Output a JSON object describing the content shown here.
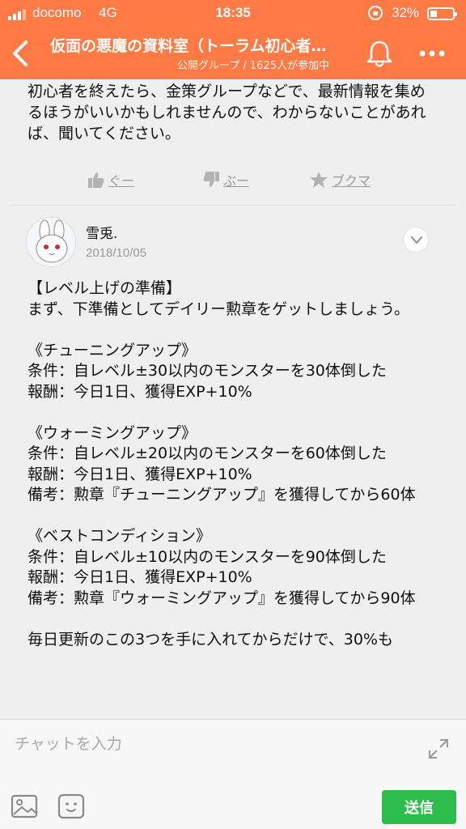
{
  "status_bar": {
    "carrier": "docomo",
    "network": "4G",
    "time": "18:35",
    "battery_percent": "32%",
    "battery_level": 0.32
  },
  "header": {
    "title": "仮面の悪魔の資料室（トーラム初心者…",
    "subtitle": "公開グループ / 1625人が参加中",
    "accent_color": "#ff7a45",
    "icons": {
      "back": "chevron-left-icon",
      "bell": "bell-icon",
      "more": "more-dots-icon"
    }
  },
  "previous_post": {
    "text": "初心者を終えたら、金策グループなどで、最新情報を集めるほうがいいかもしれませんので、わからないことがあれば、聞いてください。",
    "reactions": [
      {
        "icon": "thumbs-up-icon",
        "label": "ぐー"
      },
      {
        "icon": "thumbs-down-icon",
        "label": "ぶー"
      },
      {
        "icon": "star-icon",
        "label": "ブクマ"
      }
    ]
  },
  "post": {
    "author": "雪兎.",
    "date": "2018/10/05",
    "body": "【レベル上げの準備】\nまず、下準備としてデイリー勲章をゲットしましょう。\n\n《チューニングアップ》\n条件：自レベル±30以内のモンスターを30体倒した\n報酬：今日1日、獲得EXP+10%\n\n《ウォーミングアップ》\n条件：自レベル±20以内のモンスターを60体倒した\n報酬：今日1日、獲得EXP+10%\n備考：勲章『チューニングアップ』を獲得してから60体\n\n《ベストコンディション》\n条件：自レベル±10以内のモンスターを90体倒した\n報酬：今日1日、獲得EXP+10%\n備考：勲章『ウォーミングアップ』を獲得してから90体\n\n毎日更新のこの3つを手に入れてからだけで、30%も"
  },
  "composer": {
    "placeholder": "チャットを入力",
    "send_label": "送信",
    "send_color": "#2ebd4a",
    "icons": {
      "expand": "expand-icon",
      "image": "image-icon",
      "sticker": "sticker-icon"
    }
  }
}
